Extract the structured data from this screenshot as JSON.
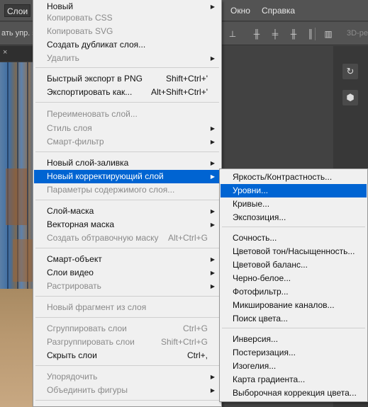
{
  "menubar": {
    "left_item": "Слои",
    "right_items": [
      "Окно",
      "Справка"
    ]
  },
  "optionsbar": {
    "left_text": "ать упр. э",
    "right_text": "3D-ре"
  },
  "layer_menu": {
    "items": [
      {
        "label": "Новый",
        "shortcut": "",
        "submenu": true,
        "disabled": false
      },
      {
        "label": "Копировать CSS",
        "shortcut": "",
        "submenu": false,
        "disabled": true
      },
      {
        "label": "Копировать SVG",
        "shortcut": "",
        "submenu": false,
        "disabled": true
      },
      {
        "label": "Создать дубликат слоя...",
        "shortcut": "",
        "submenu": false,
        "disabled": false
      },
      {
        "label": "Удалить",
        "shortcut": "",
        "submenu": true,
        "disabled": true
      },
      {
        "label": "Быстрый экспорт в PNG",
        "shortcut": "Shift+Ctrl+'",
        "submenu": false,
        "disabled": false
      },
      {
        "label": "Экспортировать как...",
        "shortcut": "Alt+Shift+Ctrl+'",
        "submenu": false,
        "disabled": false
      },
      {
        "label": "Переименовать слой...",
        "shortcut": "",
        "submenu": false,
        "disabled": true
      },
      {
        "label": "Стиль слоя",
        "shortcut": "",
        "submenu": true,
        "disabled": true
      },
      {
        "label": "Смарт-фильтр",
        "shortcut": "",
        "submenu": true,
        "disabled": true
      },
      {
        "label": "Новый слой-заливка",
        "shortcut": "",
        "submenu": true,
        "disabled": false
      },
      {
        "label": "Новый корректирующий слой",
        "shortcut": "",
        "submenu": true,
        "disabled": false,
        "highlighted": true
      },
      {
        "label": "Параметры содержимого слоя...",
        "shortcut": "",
        "submenu": false,
        "disabled": true
      },
      {
        "label": "Слой-маска",
        "shortcut": "",
        "submenu": true,
        "disabled": false
      },
      {
        "label": "Векторная маска",
        "shortcut": "",
        "submenu": true,
        "disabled": false
      },
      {
        "label": "Создать обтравочную маску",
        "shortcut": "Alt+Ctrl+G",
        "submenu": false,
        "disabled": true
      },
      {
        "label": "Смарт-объект",
        "shortcut": "",
        "submenu": true,
        "disabled": false
      },
      {
        "label": "Слои видео",
        "shortcut": "",
        "submenu": true,
        "disabled": false
      },
      {
        "label": "Растрировать",
        "shortcut": "",
        "submenu": true,
        "disabled": true
      },
      {
        "label": "Новый фрагмент из слоя",
        "shortcut": "",
        "submenu": false,
        "disabled": true
      },
      {
        "label": "Сгруппировать слои",
        "shortcut": "Ctrl+G",
        "submenu": false,
        "disabled": true
      },
      {
        "label": "Разгруппировать слои",
        "shortcut": "Shift+Ctrl+G",
        "submenu": false,
        "disabled": true
      },
      {
        "label": "Скрыть слои",
        "shortcut": "Ctrl+,",
        "submenu": false,
        "disabled": false
      },
      {
        "label": "Упорядочить",
        "shortcut": "",
        "submenu": true,
        "disabled": true
      },
      {
        "label": "Объединить фигуры",
        "shortcut": "",
        "submenu": true,
        "disabled": true
      }
    ]
  },
  "adjustment_submenu": {
    "items": [
      {
        "label": "Яркость/Контрастность...",
        "highlighted": false
      },
      {
        "label": "Уровни...",
        "highlighted": true
      },
      {
        "label": "Кривые...",
        "highlighted": false
      },
      {
        "label": "Экспозиция...",
        "highlighted": false
      },
      {
        "label": "Сочность...",
        "highlighted": false
      },
      {
        "label": "Цветовой тон/Насыщенность...",
        "highlighted": false
      },
      {
        "label": "Цветовой баланс...",
        "highlighted": false
      },
      {
        "label": "Черно-белое...",
        "highlighted": false
      },
      {
        "label": "Фотофильтр...",
        "highlighted": false
      },
      {
        "label": "Микширование каналов...",
        "highlighted": false
      },
      {
        "label": "Поиск цвета...",
        "highlighted": false
      },
      {
        "label": "Инверсия...",
        "highlighted": false
      },
      {
        "label": "Постеризация...",
        "highlighted": false
      },
      {
        "label": "Изогелия...",
        "highlighted": false
      },
      {
        "label": "Карта градиента...",
        "highlighted": false
      },
      {
        "label": "Выборочная коррекция цвета...",
        "highlighted": false
      }
    ]
  },
  "colors": {
    "highlight": "#0064d2",
    "menu_bg": "#f0f0f0",
    "disabled_text": "#8a8a8a"
  }
}
